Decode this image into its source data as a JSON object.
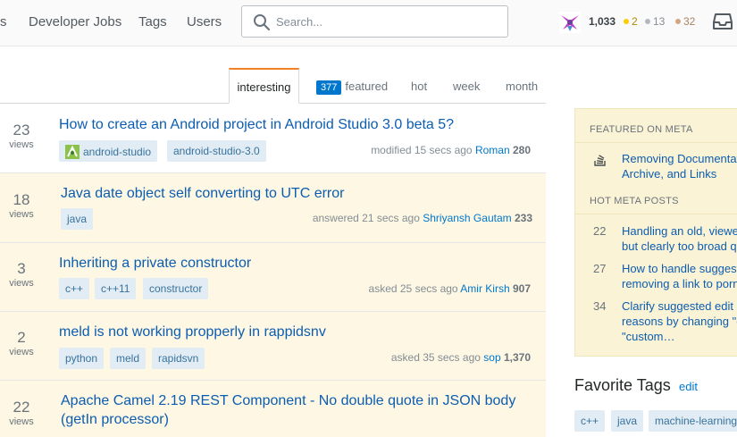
{
  "header": {
    "nav": [
      "s",
      "Developer Jobs",
      "Tags",
      "Users"
    ],
    "search_placeholder": "Search...",
    "reputation": "1,033",
    "badges": {
      "gold": "2",
      "silver": "13",
      "bronze": "32"
    },
    "colors": {
      "gold": "#ffcc01",
      "silver": "#b4b8bc",
      "bronze": "#d1a684"
    }
  },
  "tabs": {
    "interesting": "interesting",
    "featured_count": "377",
    "featured": "featured",
    "hot": "hot",
    "week": "week",
    "month": "month"
  },
  "questions": [
    {
      "votes": "23",
      "votes_label": "views",
      "title": "How to create an Android project in Android Studio 3.0 beta 5?",
      "tags": [
        "android-studio",
        "android-studio-3.0"
      ],
      "action": "modified 15 secs ago",
      "user": "Roman",
      "rep": "280"
    },
    {
      "votes": "18",
      "votes_label": "views",
      "title": "Java date object self converting to UTC error",
      "tags": [
        "java"
      ],
      "action": "answered 21 secs ago",
      "user": "Shriyansh Gautam",
      "rep": "233"
    },
    {
      "votes": "3",
      "votes_label": "views",
      "title": "Inheriting a private constructor",
      "tags": [
        "c++",
        "c++11",
        "constructor"
      ],
      "action": "asked 25 secs ago",
      "user": "Amir Kirsh",
      "rep": "907"
    },
    {
      "votes": "2",
      "votes_label": "views",
      "title": "meld is not working propperly in rappidsnv",
      "tags": [
        "python",
        "meld",
        "rapidsvn"
      ],
      "action": "asked 35 secs ago",
      "user": "sop",
      "rep": "1,370"
    },
    {
      "votes": "22",
      "votes_label": "views",
      "title_line1": "Apache Camel 2.19 REST Component - No double quote in JSON body",
      "title_line2": "(getIn processor)"
    }
  ],
  "sidebar": {
    "featured_heading": "FEATURED ON META",
    "featured_line1": "Removing Documentat",
    "featured_line2": "Archive, and Links",
    "hot_heading": "HOT META POSTS",
    "hot": [
      {
        "num": "22",
        "line1": "Handling an old, viewe",
        "line2": "but clearly too broad q"
      },
      {
        "num": "27",
        "line1": "How to handle suggest",
        "line2": "removing a link to porn"
      },
      {
        "num": "34",
        "line1": "Clarify suggested edit",
        "line2": "reasons by changing \"c",
        "line3": "\"custom…"
      }
    ],
    "favorite_title": "Favorite Tags",
    "favorite_edit": "edit",
    "favorite_tags": [
      "c++",
      "java",
      "machine-learning"
    ]
  }
}
